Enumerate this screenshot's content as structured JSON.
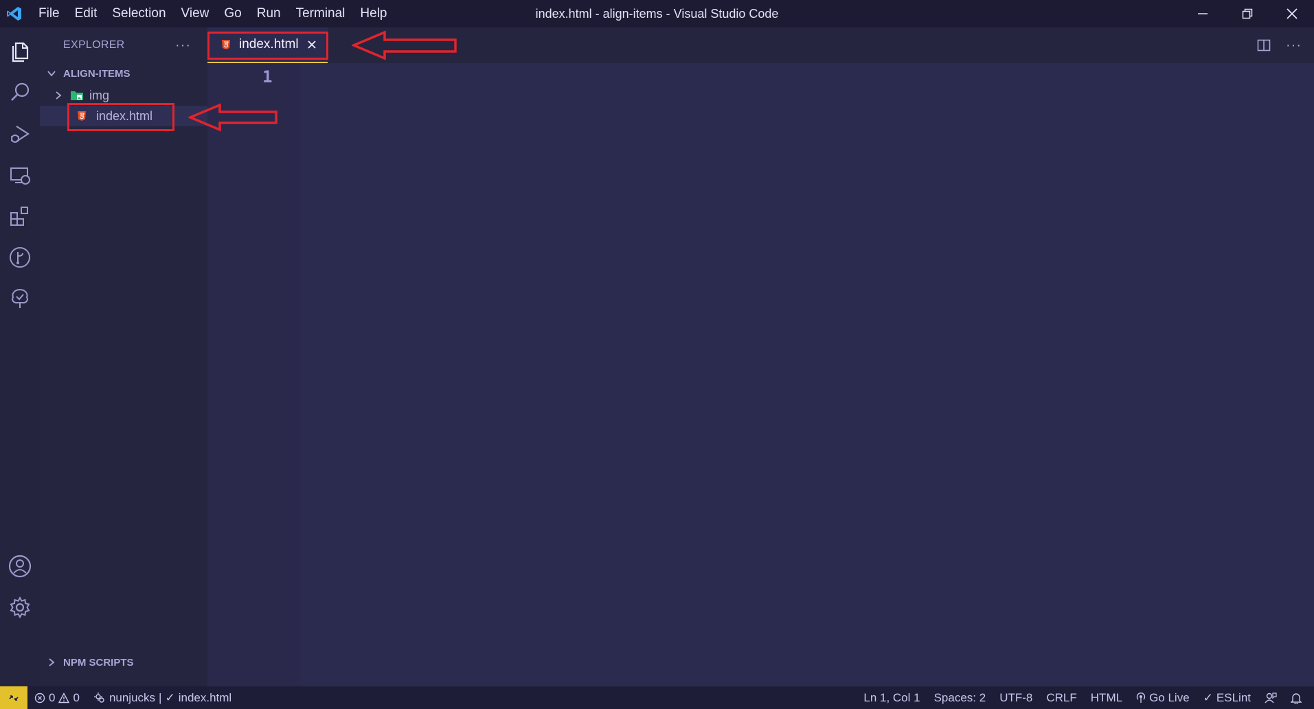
{
  "window": {
    "title": "index.html - align-items - Visual Studio Code",
    "menu": [
      "File",
      "Edit",
      "Selection",
      "View",
      "Go",
      "Run",
      "Terminal",
      "Help"
    ]
  },
  "activity_bar": {
    "items": [
      "explorer-icon",
      "search-icon",
      "run-debug-icon",
      "remote-explorer-icon",
      "extensions-icon",
      "source-control-icon",
      "tree-icon"
    ],
    "bottom": [
      "account-icon",
      "settings-gear-icon"
    ]
  },
  "sidebar": {
    "title": "EXPLORER",
    "folder": "ALIGN-ITEMS",
    "items": [
      {
        "label": "img",
        "type": "folder"
      },
      {
        "label": "index.html",
        "type": "file"
      }
    ],
    "npm_section": "NPM SCRIPTS"
  },
  "editor": {
    "tab_label": "index.html",
    "line_number": "1"
  },
  "statusbar": {
    "errors": "0",
    "warnings": "0",
    "template": "nunjucks",
    "file_check": "index.html",
    "position": "Ln 1, Col 1",
    "spaces": "Spaces: 2",
    "encoding": "UTF-8",
    "eol": "CRLF",
    "language": "HTML",
    "go_live": "Go Live",
    "eslint": "ESLint"
  },
  "colors": {
    "accent_yellow": "#e2c12d",
    "annotation_red": "#e0242e",
    "html_icon": "#e44d26",
    "folder_icon": "#2bb673"
  }
}
